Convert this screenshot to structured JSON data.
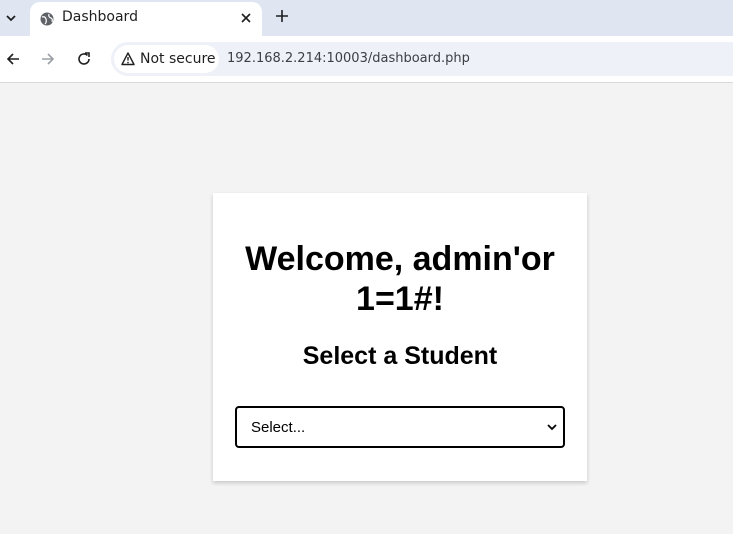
{
  "browser": {
    "tab": {
      "title": "Dashboard",
      "favicon": "globe-icon",
      "close_icon": "close-icon"
    },
    "new_tab_icon": "plus-icon",
    "tab_menu_icon": "chevron-down-icon",
    "toolbar": {
      "back_icon": "back-arrow-icon",
      "forward_icon": "forward-arrow-icon",
      "reload_icon": "reload-icon",
      "security_label": "Not secure",
      "security_icon": "warning-triangle-icon",
      "url": "192.168.2.214:10003/dashboard.php"
    }
  },
  "page": {
    "welcome": "Welcome, admin'or 1=1#!",
    "subtitle": "Select a Student",
    "student_select": {
      "selected": "Select..."
    }
  }
}
